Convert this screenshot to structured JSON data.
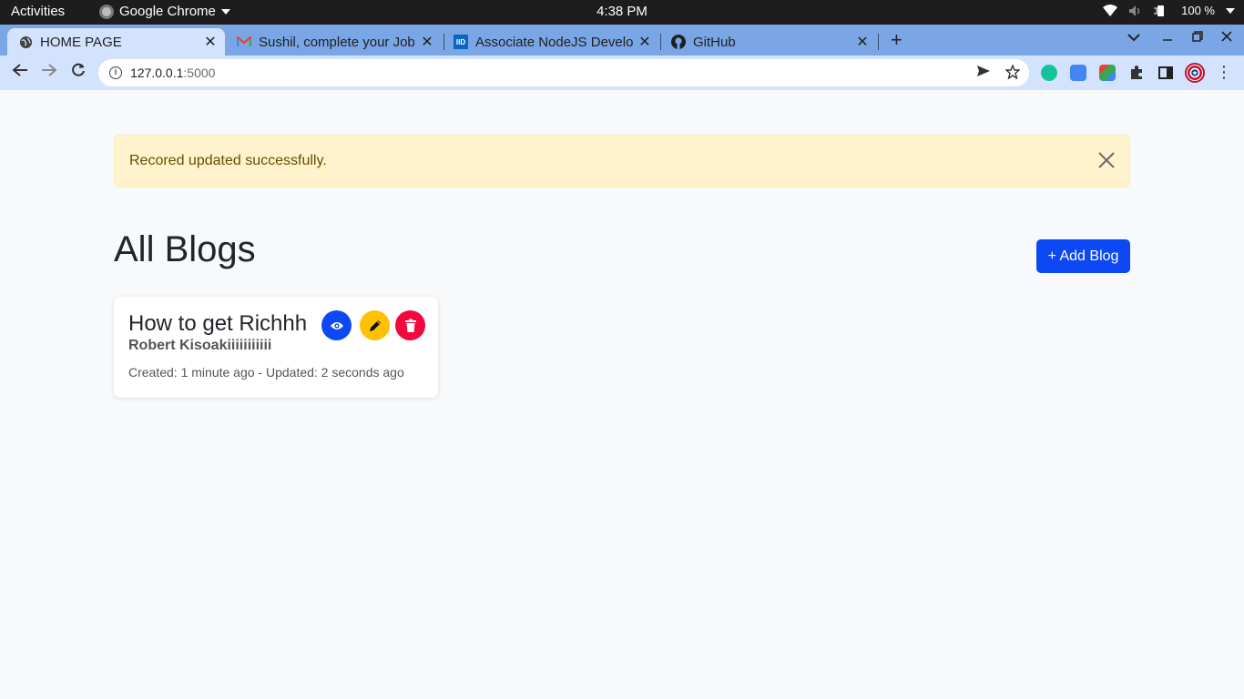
{
  "os_bar": {
    "activities": "Activities",
    "app_name": "Google Chrome",
    "clock": "4:38 PM",
    "battery": "100 %"
  },
  "tabs": [
    {
      "title": "HOME PAGE",
      "favicon": "globe-icon",
      "active": true
    },
    {
      "title": "Sushil, complete your Job",
      "favicon": "gmail-icon",
      "active": false
    },
    {
      "title": "Associate NodeJS Develo",
      "favicon": "iide-icon",
      "active": false
    },
    {
      "title": "GitHub",
      "favicon": "github-icon",
      "active": false
    }
  ],
  "address_bar": {
    "host": "127.0.0.1",
    "port": ":5000"
  },
  "alert": {
    "message": "Recored updated successfully."
  },
  "main": {
    "heading": "All Blogs",
    "add_button": "+ Add Blog"
  },
  "blogs": [
    {
      "title": "How to get Richhh",
      "author": "Robert Kisoakiiiiiiiiiii",
      "meta": "Created: 1 minute ago - Updated: 2 seconds ago"
    }
  ],
  "colors": {
    "primary": "#0d48f5",
    "warning": "#ffc107",
    "danger": "#f2083b",
    "alert_bg": "#fff3cd",
    "alert_text": "#664d03"
  }
}
